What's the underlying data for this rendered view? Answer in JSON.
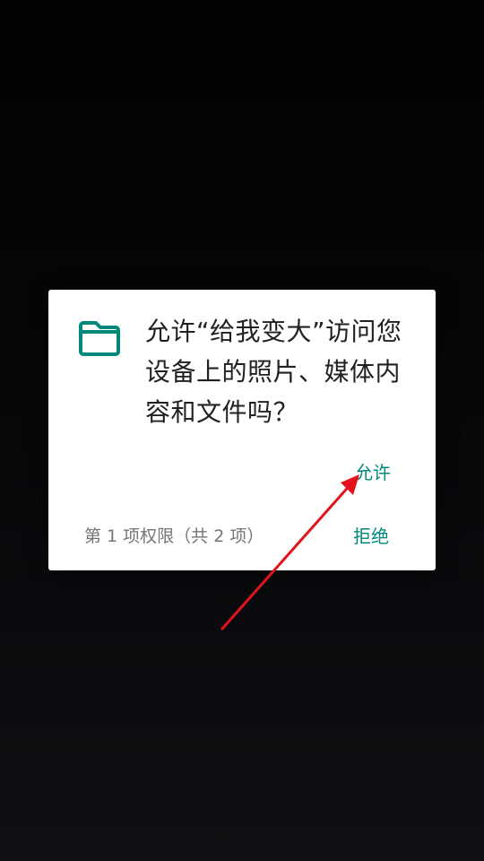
{
  "dialog": {
    "icon": "folder-icon",
    "message": "允许“给我变大”访问您设备上的照片、媒体内容和文件吗？",
    "allow_label": "允许",
    "deny_label": "拒绝",
    "counter": "第 1 项权限（共 2 项）"
  },
  "colors": {
    "accent": "#00897b",
    "annotation_arrow": "#e3131b",
    "background": "#050607"
  }
}
